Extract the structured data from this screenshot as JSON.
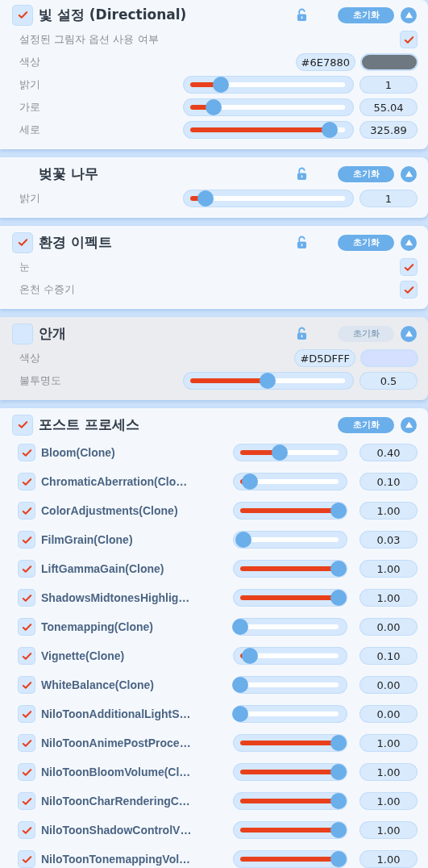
{
  "panels": [
    {
      "title": "빛 설정 (Directional)",
      "checked": true,
      "enabled": true,
      "lockable": true,
      "reset": "초기화",
      "expanded": true,
      "rows": [
        {
          "kind": "checkbox",
          "label": "설정된 그림자 옵션 사용 여부",
          "checked": true
        },
        {
          "kind": "color",
          "label": "색상",
          "hex": "#6E7880",
          "color": "#6e7880"
        },
        {
          "kind": "slider",
          "label": "밝기",
          "level": 0.2,
          "value": "1"
        },
        {
          "kind": "slider",
          "label": "가로",
          "level": 0.15,
          "value": "55.04"
        },
        {
          "kind": "slider",
          "label": "세로",
          "level": 0.9,
          "value": "325.89"
        }
      ]
    },
    {
      "title": "벚꽃 나무",
      "enabled": true,
      "lockable": true,
      "reset": "초기화",
      "expanded": true,
      "rows": [
        {
          "kind": "slider",
          "label": "밝기",
          "level": 0.1,
          "value": "1"
        }
      ]
    },
    {
      "title": "환경 이펙트",
      "checked": true,
      "enabled": true,
      "lockable": true,
      "reset": "초기화",
      "expanded": true,
      "rows": [
        {
          "kind": "checkbox",
          "label": "눈",
          "checked": true
        },
        {
          "kind": "checkbox",
          "label": "온천 수증기",
          "checked": true
        }
      ]
    },
    {
      "title": "안개",
      "checked": false,
      "enabled": false,
      "lockable": true,
      "reset": "초기화",
      "expanded": true,
      "rows": [
        {
          "kind": "color",
          "label": "색상",
          "hex": "#D5DFFF",
          "color": "#d5dfff"
        },
        {
          "kind": "slider",
          "label": "불투명도",
          "level": 0.5,
          "value": "0.5"
        }
      ]
    },
    {
      "title": "포스트 프로세스",
      "checked": true,
      "enabled": true,
      "lockable": false,
      "reset": "초기화",
      "expanded": true,
      "rows": [
        {
          "kind": "effect",
          "label": "Bloom(Clone)",
          "checked": true,
          "level": 0.4,
          "value": "0.40"
        },
        {
          "kind": "effect",
          "label": "ChromaticAberration(Clo…",
          "checked": true,
          "level": 0.1,
          "value": "0.10"
        },
        {
          "kind": "effect",
          "label": "ColorAdjustments(Clone)",
          "checked": true,
          "level": 1,
          "value": "1.00"
        },
        {
          "kind": "effect",
          "label": "FilmGrain(Clone)",
          "checked": true,
          "level": 0.03,
          "value": "0.03"
        },
        {
          "kind": "effect",
          "label": "LiftGammaGain(Clone)",
          "checked": true,
          "level": 1,
          "value": "1.00"
        },
        {
          "kind": "effect",
          "label": "ShadowsMidtonesHighlig…",
          "checked": true,
          "level": 1,
          "value": "1.00"
        },
        {
          "kind": "effect",
          "label": "Tonemapping(Clone)",
          "checked": true,
          "level": 0,
          "value": "0.00"
        },
        {
          "kind": "effect",
          "label": "Vignette(Clone)",
          "checked": true,
          "level": 0.1,
          "value": "0.10"
        },
        {
          "kind": "effect",
          "label": "WhiteBalance(Clone)",
          "checked": true,
          "level": 0,
          "value": "0.00"
        },
        {
          "kind": "effect",
          "label": "NiloToonAdditionalLightS…",
          "checked": true,
          "level": 0,
          "value": "0.00"
        },
        {
          "kind": "effect",
          "label": "NiloToonAnimePostProce…",
          "checked": true,
          "level": 1,
          "value": "1.00"
        },
        {
          "kind": "effect",
          "label": "NiloToonBloomVolume(Cl…",
          "checked": true,
          "level": 1,
          "value": "1.00"
        },
        {
          "kind": "effect",
          "label": "NiloToonCharRenderingC…",
          "checked": true,
          "level": 1,
          "value": "1.00"
        },
        {
          "kind": "effect",
          "label": "NiloToonShadowControlV…",
          "checked": true,
          "level": 1,
          "value": "1.00"
        },
        {
          "kind": "effect",
          "label": "NiloToonTonemappingVol…",
          "checked": true,
          "level": 1,
          "value": "1.00"
        }
      ]
    }
  ]
}
